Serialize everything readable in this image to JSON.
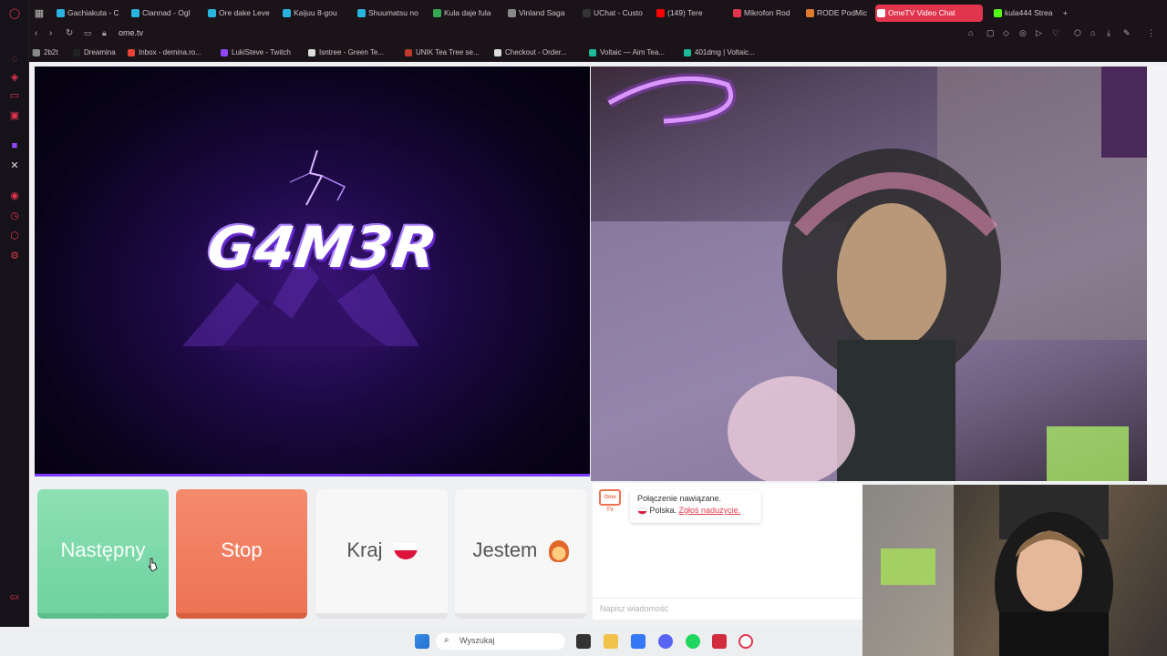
{
  "browser": {
    "tabs": [
      {
        "label": "Gachiakuta - C",
        "color": "#2bb3e0"
      },
      {
        "label": "Clannad - Ogl",
        "color": "#2bb3e0"
      },
      {
        "label": "Ore dake Leve",
        "color": "#2bb3e0"
      },
      {
        "label": "Kaijuu 8-gou",
        "color": "#2bb3e0"
      },
      {
        "label": "Shuumatsu no",
        "color": "#2bb3e0"
      },
      {
        "label": "Kula daje fula",
        "color": "#34a853"
      },
      {
        "label": "Vinland Saga",
        "color": "#888888"
      },
      {
        "label": "UChat - Custo",
        "color": "#333333"
      },
      {
        "label": "(149) Tere",
        "color": "#ff0000"
      },
      {
        "label": "Mikrofon Rod",
        "color": "#e0354d"
      },
      {
        "label": "RODE PodMic",
        "color": "#e07b2b"
      },
      {
        "label": "OmeTV Video Chat",
        "color": "#ffffff",
        "active": true
      },
      {
        "label": "kula444 Strea",
        "color": "#53fc18"
      }
    ],
    "url": "ome.tv",
    "bookmarks": [
      {
        "label": "2b2t",
        "color": "#888"
      },
      {
        "label": "Dreamina",
        "color": "#222"
      },
      {
        "label": "Inbox - demina.ro...",
        "color": "#ea4335"
      },
      {
        "label": "LukiSteve - Twitch",
        "color": "#9146ff"
      },
      {
        "label": "Isntree - Green Te...",
        "color": "#ddd"
      },
      {
        "label": "UNIK Tea Tree se...",
        "color": "#c0392b"
      },
      {
        "label": "Checkout - Order...",
        "color": "#ddd"
      },
      {
        "label": "Voltaic — Aim Tea...",
        "color": "#1abc9c"
      },
      {
        "label": "401dmg | Voltaic...",
        "color": "#1abc9c"
      }
    ]
  },
  "stream": {
    "logo_text": "G4M3R"
  },
  "controls": {
    "next": "Następny",
    "stop": "Stop",
    "country": "Kraj",
    "iam": "Jestem"
  },
  "chat": {
    "logo_text": "Ome TV",
    "connected": "Połączenie nawiązane.",
    "country": "Polska.",
    "report": "Zgłoś nadużycie.",
    "input_placeholder": "Napisz wiadomość"
  },
  "taskbar": {
    "search_placeholder": "Wyszukaj"
  }
}
